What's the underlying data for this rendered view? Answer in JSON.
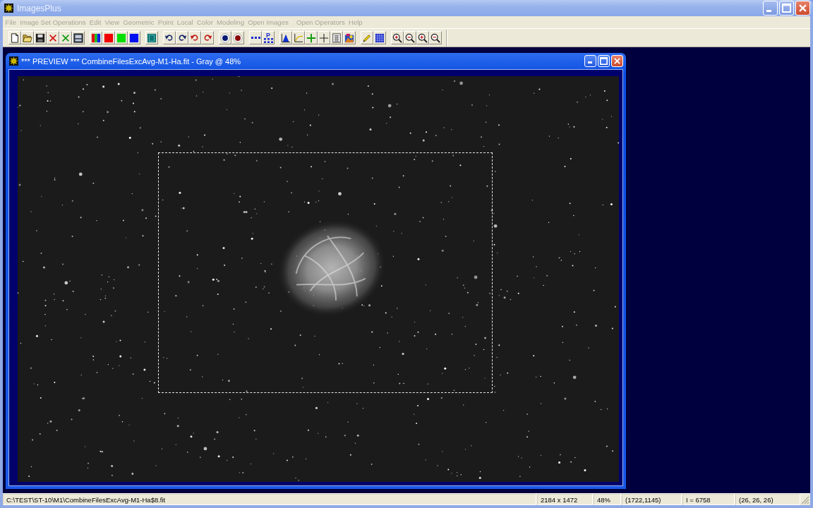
{
  "window": {
    "title": "ImagesPlus"
  },
  "menu": [
    {
      "label": "File",
      "disabled": true
    },
    {
      "label": "Image Set Operations",
      "disabled": true
    },
    {
      "label": "Edit",
      "disabled": true
    },
    {
      "label": "View",
      "disabled": true
    },
    {
      "label": "Geometric",
      "disabled": true
    },
    {
      "label": "Point",
      "disabled": true
    },
    {
      "label": "Local",
      "disabled": true
    },
    {
      "label": "Color",
      "disabled": true
    },
    {
      "label": "Modeling",
      "disabled": true
    },
    {
      "label": "Open Images",
      "disabled": true
    },
    {
      "label": "Open Operators",
      "disabled": true
    },
    {
      "label": "Help",
      "disabled": true
    }
  ],
  "toolbar": {
    "points_icon_letter": "P"
  },
  "document_window": {
    "title": "*** PREVIEW *** CombineFilesExcAvg-M1-Ha.fit - Gray @ 48%"
  },
  "status_bar": [
    "C:\\TEST\\ST-10\\M1\\CombineFilesExcAvg-M1-Ha$8.fit",
    "2184 x 1472",
    "48%",
    "(1722,1145)",
    "I = 6758",
    "(26, 26, 26)"
  ]
}
